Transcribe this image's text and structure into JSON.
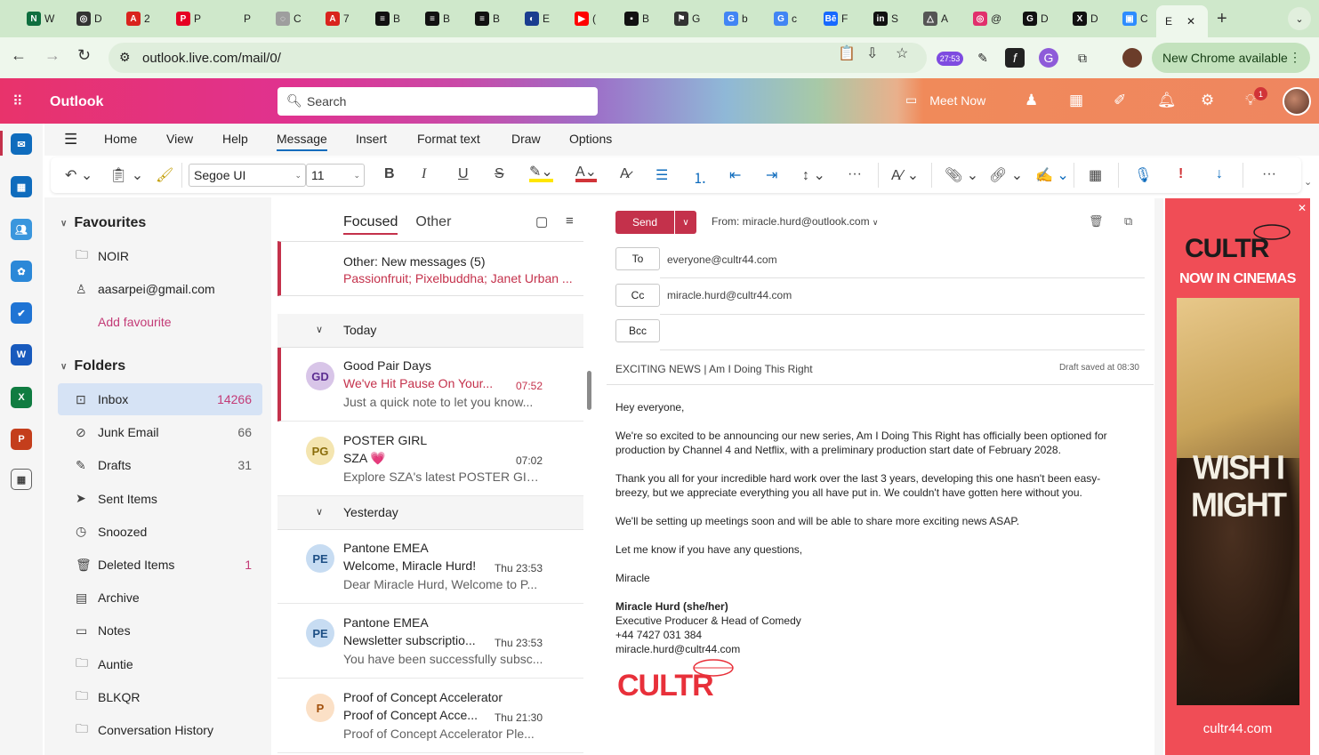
{
  "browser": {
    "tabs": [
      {
        "letter": "W",
        "color": "#0f6e3f",
        "icon": "N"
      },
      {
        "letter": "D",
        "color": "#333333",
        "icon": "◎"
      },
      {
        "letter": "2",
        "color": "#d9231d",
        "icon": "A"
      },
      {
        "letter": "P",
        "color": "#e60023",
        "icon": "P"
      },
      {
        "letter": "P",
        "color": "#cfe8cb",
        "icon": ""
      },
      {
        "letter": "C",
        "color": "#9e9e9e",
        "icon": "◌"
      },
      {
        "letter": "7",
        "color": "#d9231d",
        "icon": "A"
      },
      {
        "letter": "B",
        "color": "#111111",
        "icon": "≡"
      },
      {
        "letter": "B",
        "color": "#111111",
        "icon": "≡"
      },
      {
        "letter": "B",
        "color": "#111111",
        "icon": "≡"
      },
      {
        "letter": "E",
        "color": "#1a3d8f",
        "icon": "◐"
      },
      {
        "letter": "(",
        "color": "#ff0000",
        "icon": "▶"
      },
      {
        "letter": "B",
        "color": "#111111",
        "icon": "▪"
      },
      {
        "letter": "G",
        "color": "#333333",
        "icon": "⚑"
      },
      {
        "letter": "b",
        "color": "#4285f4",
        "icon": "G"
      },
      {
        "letter": "c",
        "color": "#4285f4",
        "icon": "G"
      },
      {
        "letter": "F",
        "color": "#1769ff",
        "icon": "Bē"
      },
      {
        "letter": "S",
        "color": "#111111",
        "icon": "in"
      },
      {
        "letter": "A",
        "color": "#555555",
        "icon": "△"
      },
      {
        "letter": "@",
        "color": "#e1306c",
        "icon": "◎"
      },
      {
        "letter": "D",
        "color": "#111111",
        "icon": "G"
      },
      {
        "letter": "D",
        "color": "#111111",
        "icon": "X"
      },
      {
        "letter": "C",
        "color": "#2d8cff",
        "icon": "▣"
      }
    ],
    "active_tab_letter": "E",
    "active_tab_icon": "O",
    "url": "outlook.live.com/mail/0/",
    "timer_badge": "27:53",
    "new_chrome_label": "New Chrome available"
  },
  "outlook": {
    "brand": "Outlook",
    "search_placeholder": "Search",
    "meet_now": "Meet Now",
    "notification_count": "1",
    "menu_tabs": [
      "Home",
      "View",
      "Help",
      "Message",
      "Insert",
      "Format text",
      "Draw",
      "Options"
    ],
    "active_menu": "Message",
    "ribbon": {
      "font": "Segoe UI",
      "size": "11"
    }
  },
  "folders": {
    "favourites_title": "Favourites",
    "favourites": [
      {
        "name": "NOIR",
        "icon": "folder-icon"
      },
      {
        "name": "aasarpei@gmail.com",
        "icon": "person-icon"
      }
    ],
    "add_favourite": "Add favourite",
    "folders_title": "Folders",
    "items": [
      {
        "name": "Inbox",
        "count": "14266",
        "icon": "inbox-icon",
        "selected": true
      },
      {
        "name": "Junk Email",
        "count": "66",
        "icon": "junk-icon"
      },
      {
        "name": "Drafts",
        "count": "31",
        "icon": "drafts-icon"
      },
      {
        "name": "Sent Items",
        "count": "",
        "icon": "send-icon"
      },
      {
        "name": "Snoozed",
        "count": "",
        "icon": "clock-icon"
      },
      {
        "name": "Deleted Items",
        "count": "1",
        "icon": "trash-icon"
      },
      {
        "name": "Archive",
        "count": "",
        "icon": "archive-icon"
      },
      {
        "name": "Notes",
        "count": "",
        "icon": "note-icon"
      },
      {
        "name": "Auntie",
        "count": "",
        "icon": "folder-icon"
      },
      {
        "name": "BLKQR",
        "count": "",
        "icon": "folder-icon"
      },
      {
        "name": "Conversation History",
        "count": "",
        "icon": "folder-icon"
      }
    ]
  },
  "message_list": {
    "pivot_focused": "Focused",
    "pivot_other": "Other",
    "other_banner_title": "Other: New messages (5)",
    "other_banner_senders": "Passionfruit; Pixelbuddha; Janet Urban ...",
    "group_today": "Today",
    "group_yesterday": "Yesterday",
    "messages": [
      {
        "initials": "GD",
        "from": "Good Pair Days",
        "subject": "We've Hit Pause On Your...",
        "time": "07:52",
        "preview": "Just a quick note to let you know...",
        "unread": true,
        "avatar_bg": "#d8c5e8",
        "avatar_fg": "#5c2e91"
      },
      {
        "initials": "PG",
        "from": "POSTER GIRL",
        "subject": "SZA 💗",
        "time": "07:02",
        "preview": "Explore SZA's latest POSTER GIRL...",
        "unread": false,
        "avatar_bg": "#f4e5b0",
        "avatar_fg": "#8a6d0b"
      },
      {
        "initials": "PE",
        "from": "Pantone EMEA",
        "subject": "Welcome, Miracle Hurd!",
        "time": "Thu 23:53",
        "preview": "Dear Miracle Hurd, Welcome to P...",
        "unread": false,
        "avatar_bg": "#c7dcf2",
        "avatar_fg": "#1d4f85"
      },
      {
        "initials": "PE",
        "from": "Pantone EMEA",
        "subject": "Newsletter subscriptio...",
        "time": "Thu 23:53",
        "preview": "You have been successfully subsc...",
        "unread": false,
        "avatar_bg": "#c7dcf2",
        "avatar_fg": "#1d4f85"
      },
      {
        "initials": "P",
        "from": "Proof of Concept Accelerator",
        "subject": "Proof of Concept Acce...",
        "time": "Thu 21:30",
        "preview": "Proof of Concept Accelerator Ple...",
        "unread": false,
        "avatar_bg": "#fbe0c6",
        "avatar_fg": "#a14f0b"
      }
    ]
  },
  "compose": {
    "send": "Send",
    "from": "From: miracle.hurd@outlook.com",
    "to_label": "To",
    "to_value": "everyone@cultr44.com",
    "cc_label": "Cc",
    "cc_value": "miracle.hurd@cultr44.com",
    "bcc_label": "Bcc",
    "subject": "EXCITING NEWS | Am I Doing This Right",
    "draft_saved": "Draft saved at 08:30",
    "greeting": "Hey everyone,",
    "para1": "We're so excited to be announcing our new series, Am I Doing This Right has officially been optioned for production by Channel 4 and Netflix, with a preliminary production start date of February 2028.",
    "para2": "Thank you all for your incredible hard work over the last 3 years, developing this one hasn't been easy-breezy, but we appreciate everything you all have put in. We couldn't have gotten here without you.",
    "para3": "We'll be setting up meetings soon and will be able to share more exciting news ASAP.",
    "para4": "Let me know if you have any questions,",
    "signoff": "Miracle",
    "sig_name": "Miracle Hurd (she/her)",
    "sig_title": "Executive Producer & Head of Comedy",
    "sig_phone": "+44 7427 031 384",
    "sig_email": "miracle.hurd@cultr44.com",
    "sig_logo": "CULTR"
  },
  "ad": {
    "logo": "CULTR",
    "tagline": "NOW IN CINEMAS",
    "poster_text": "WISH I MIGHT",
    "site": "cultr44.com",
    "color": "#f04d56"
  }
}
